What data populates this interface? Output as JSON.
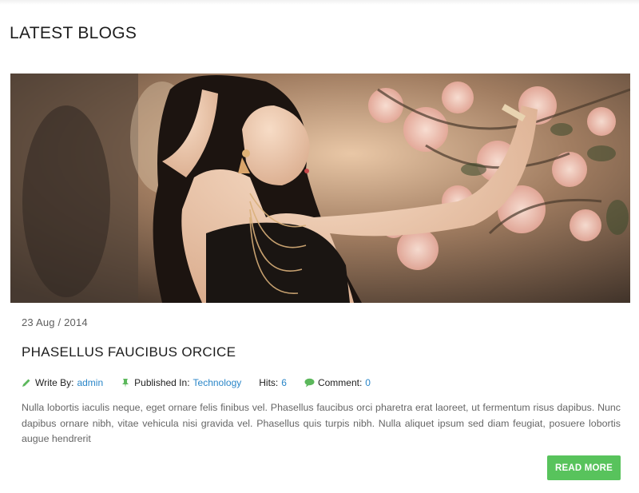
{
  "section": {
    "title": "LATEST BLOGS"
  },
  "post": {
    "date": "23 Aug / 2014",
    "title": "PHASELLUS FAUCIBUS ORCICE",
    "meta": {
      "author_label": "Write By:",
      "author": "admin",
      "category_label": "Published In:",
      "category": "Technology",
      "hits_label": "Hits:",
      "hits": "6",
      "comment_label": "Comment:",
      "comments": "0"
    },
    "excerpt": "Nulla lobortis iaculis neque, eget ornare felis finibus vel. Phasellus faucibus orci pharetra erat laoreet, ut fermentum risus dapibus. Nunc dapibus ornare nibh, vitae vehicula nisi gravida vel. Phasellus quis turpis nibh. Nulla aliquet ipsum sed diam feugiat, posuere lobortis augue hendrerit",
    "read_more_label": "READ MORE"
  },
  "icons": {
    "author": "pencil-icon",
    "category": "pin-icon",
    "comments": "comment-bubble-icon"
  },
  "colors": {
    "accent_green": "#58c35c",
    "link_blue": "#2a86c8",
    "icon_green": "#5cb85c"
  }
}
